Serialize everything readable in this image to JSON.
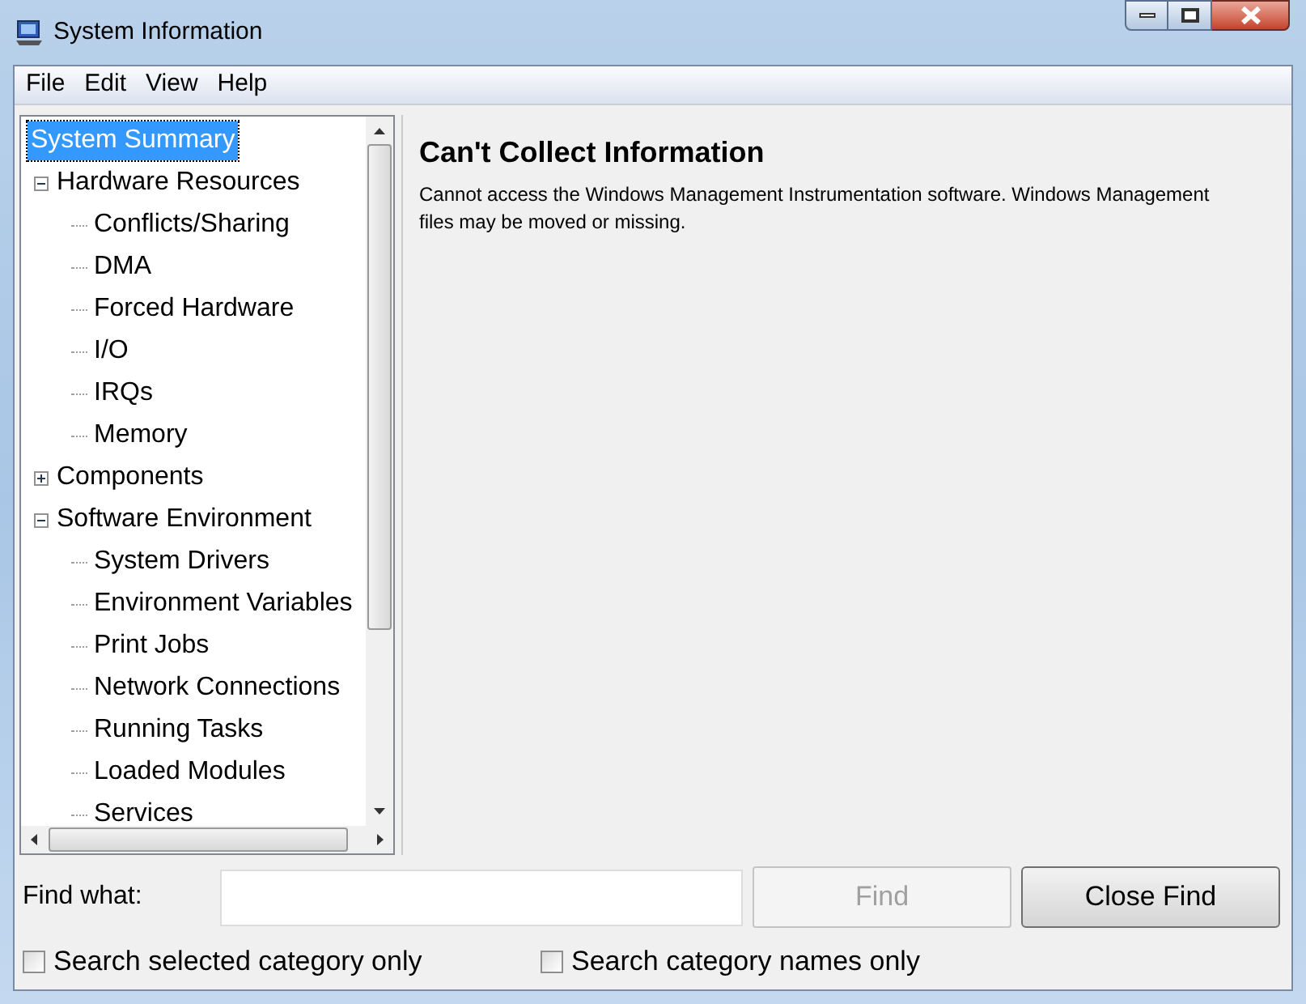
{
  "window": {
    "title": "System Information"
  },
  "menu": [
    {
      "label": "File"
    },
    {
      "label": "Edit"
    },
    {
      "label": "View"
    },
    {
      "label": "Help"
    }
  ],
  "tree": [
    {
      "label": "System Summary",
      "selected": true,
      "children": [
        {
          "label": "Hardware Resources",
          "selected": false,
          "expanded": true,
          "children": [
            {
              "label": "Conflicts/Sharing",
              "selected": false
            },
            {
              "label": "DMA",
              "selected": false
            },
            {
              "label": "Forced Hardware",
              "selected": false
            },
            {
              "label": "I/O",
              "selected": false
            },
            {
              "label": "IRQs",
              "selected": false
            },
            {
              "label": "Memory",
              "selected": false
            }
          ]
        },
        {
          "label": "Components",
          "selected": false,
          "expanded": false
        },
        {
          "label": "Software Environment",
          "selected": false,
          "expanded": true,
          "children": [
            {
              "label": "System Drivers",
              "selected": false
            },
            {
              "label": "Environment Variables",
              "selected": false
            },
            {
              "label": "Print Jobs",
              "selected": false
            },
            {
              "label": "Network Connections",
              "selected": false
            },
            {
              "label": "Running Tasks",
              "selected": false
            },
            {
              "label": "Loaded Modules",
              "selected": false
            },
            {
              "label": "Services",
              "selected": false
            }
          ]
        }
      ]
    }
  ],
  "content": {
    "heading": "Can't Collect Information",
    "message": "Cannot access the Windows Management Instrumentation software. Windows Management files may be moved or missing."
  },
  "find": {
    "label": "Find what:",
    "find_button": {
      "label": "Find",
      "disabled": true
    },
    "close_button": {
      "label": "Close Find"
    },
    "options": [
      {
        "label": "Search selected category only",
        "checked": false
      },
      {
        "label": "Search category names only",
        "checked": false
      }
    ]
  }
}
